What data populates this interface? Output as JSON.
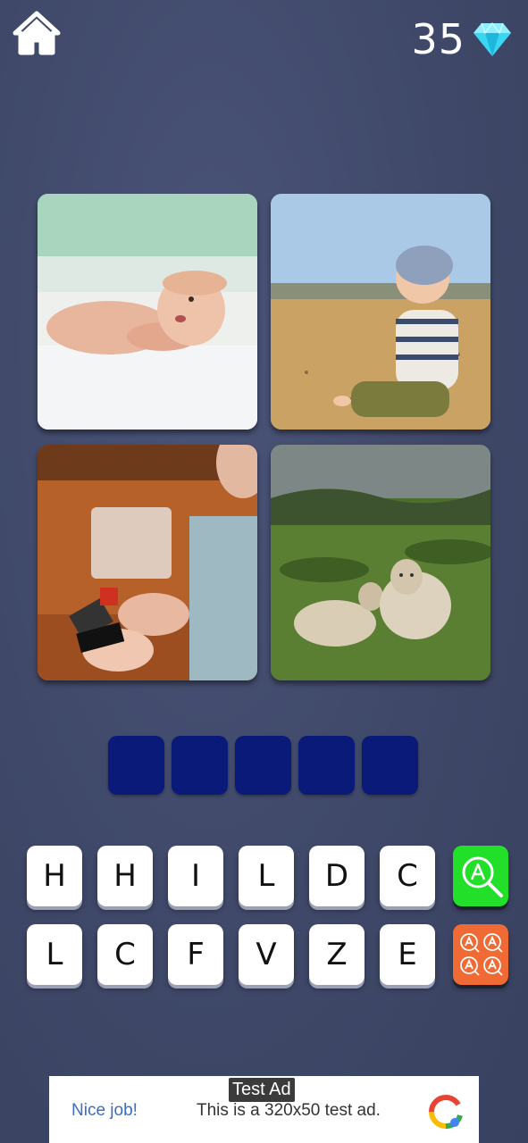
{
  "header": {
    "home_icon": "home-icon",
    "gem_count": "35",
    "gem_icon": "diamond-icon"
  },
  "pictures": [
    {
      "subject": "baby"
    },
    {
      "subject": "toddler on beach"
    },
    {
      "subject": "child playing with toy"
    },
    {
      "subject": "sheep"
    }
  ],
  "answer_slots": [
    "",
    "",
    "",
    "",
    ""
  ],
  "letters": {
    "row1": [
      "H",
      "H",
      "I",
      "L",
      "D",
      "C"
    ],
    "row2": [
      "L",
      "C",
      "F",
      "V",
      "Z",
      "E"
    ]
  },
  "helpers": {
    "hint_icon": "magnify-letter-icon",
    "reveal_icon": "multi-letter-reveal-icon"
  },
  "ad": {
    "badge": "Test Ad",
    "headline": "Nice job!",
    "body": "This is a 320x50 test ad."
  },
  "colors": {
    "slot": "#0a1a78",
    "hint": "#22e02a",
    "reveal": "#f06a35",
    "gem": "#3ad6f2"
  }
}
